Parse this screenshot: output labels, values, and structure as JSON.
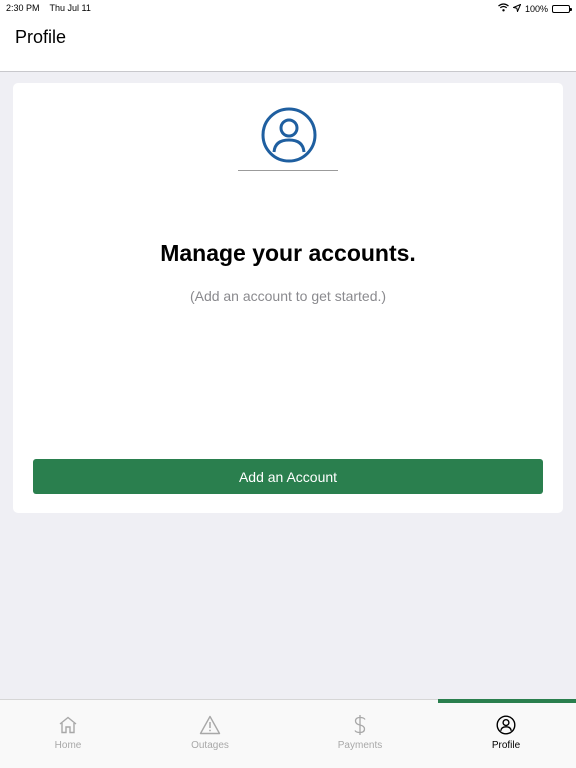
{
  "status_bar": {
    "time": "2:30 PM",
    "date": "Thu Jul 11",
    "battery": "100%"
  },
  "header": {
    "title": "Profile"
  },
  "card": {
    "headline": "Manage your accounts.",
    "subtext": "(Add an account to get started.)",
    "button_label": "Add an Account"
  },
  "tabs": [
    {
      "label": "Home",
      "icon": "home-icon",
      "active": false
    },
    {
      "label": "Outages",
      "icon": "warning-icon",
      "active": false
    },
    {
      "label": "Payments",
      "icon": "dollar-icon",
      "active": false
    },
    {
      "label": "Profile",
      "icon": "profile-icon",
      "active": true
    }
  ],
  "colors": {
    "accent": "#2a7f4e",
    "avatar": "#1f5fa0",
    "background": "#efeff4"
  }
}
